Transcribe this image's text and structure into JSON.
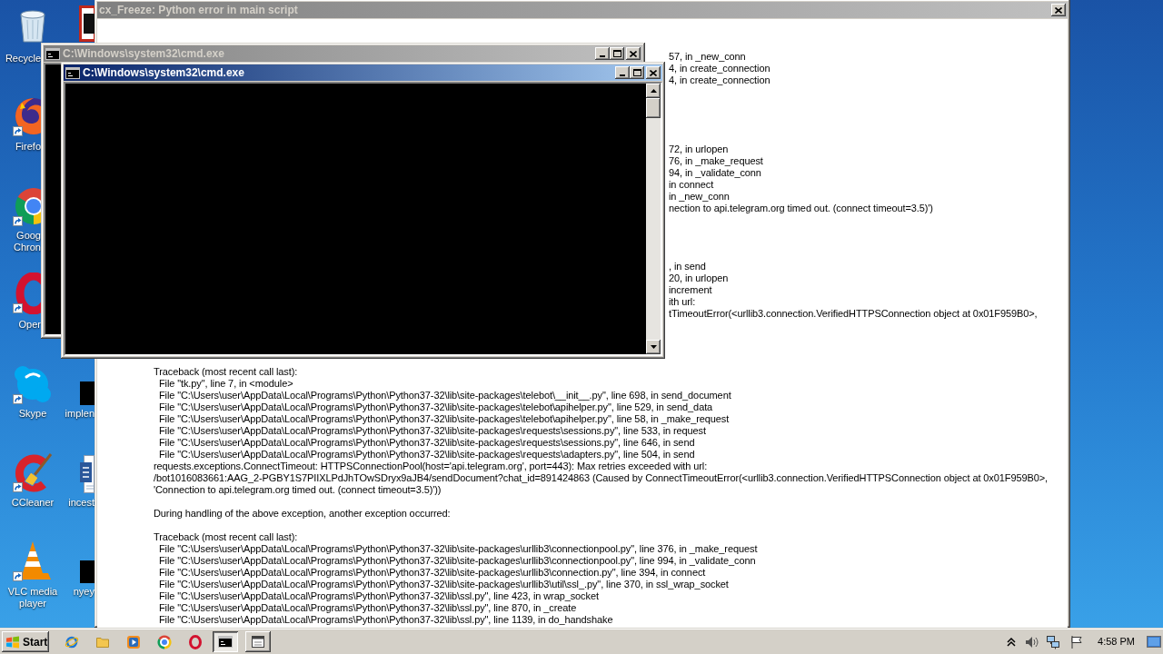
{
  "desktop_icons": [
    {
      "label": "Recycle",
      "shortcut": false
    },
    {
      "label": "Firefo",
      "shortcut": true
    },
    {
      "label": "Goog Chron",
      "shortcut": true
    },
    {
      "label": "Oper",
      "shortcut": true
    },
    {
      "label": "Skype",
      "shortcut": true
    },
    {
      "label": "CCleaner",
      "shortcut": true
    },
    {
      "label": "VLC media player",
      "shortcut": true
    },
    {
      "label": "implen",
      "shortcut": false
    },
    {
      "label": "incest",
      "shortcut": false
    },
    {
      "label": "nyey",
      "shortcut": false
    }
  ],
  "error_window": {
    "title": "cx_Freeze: Python error in main script",
    "active": false,
    "text_blocks": [
      {
        "lines": [
          "57, in _new_conn",
          "4, in create_connection",
          "4, in create_connection"
        ]
      },
      {
        "lines": [
          "72, in urlopen",
          "76, in _make_request",
          "94, in _validate_conn",
          "in connect",
          "in _new_conn",
          "nection to api.telegram.org timed out. (connect timeout=3.5)')"
        ]
      },
      {
        "lines": [
          ", in send",
          "20, in urlopen",
          "increment",
          "ith url:",
          "tTimeoutError(<urllib3.connection.VerifiedHTTPSConnection object at 0x01F959B0>,"
        ]
      },
      {
        "lines": [
          "Traceback (most recent call last):",
          "  File \"tk.py\", line 7, in <module>",
          "  File \"C:\\Users\\user\\AppData\\Local\\Programs\\Python\\Python37-32\\lib\\site-packages\\telebot\\__init__.py\", line 698, in send_document",
          "  File \"C:\\Users\\user\\AppData\\Local\\Programs\\Python\\Python37-32\\lib\\site-packages\\telebot\\apihelper.py\", line 529, in send_data",
          "  File \"C:\\Users\\user\\AppData\\Local\\Programs\\Python\\Python37-32\\lib\\site-packages\\telebot\\apihelper.py\", line 58, in _make_request",
          "  File \"C:\\Users\\user\\AppData\\Local\\Programs\\Python\\Python37-32\\lib\\site-packages\\requests\\sessions.py\", line 533, in request",
          "  File \"C:\\Users\\user\\AppData\\Local\\Programs\\Python\\Python37-32\\lib\\site-packages\\requests\\sessions.py\", line 646, in send",
          "  File \"C:\\Users\\user\\AppData\\Local\\Programs\\Python\\Python37-32\\lib\\site-packages\\requests\\adapters.py\", line 504, in send",
          "requests.exceptions.ConnectTimeout: HTTPSConnectionPool(host='api.telegram.org', port=443): Max retries exceeded with url:",
          "/bot1016083661:AAG_2-PGBY1S7PIIXLPdJhTOwSDryx9aJB4/sendDocument?chat_id=891424863 (Caused by ConnectTimeoutError(<urllib3.connection.VerifiedHTTPSConnection object at 0x01F959B0>,",
          "'Connection to api.telegram.org timed out. (connect timeout=3.5)'))"
        ]
      },
      {
        "lines": [
          "During handling of the above exception, another exception occurred:"
        ]
      },
      {
        "lines": [
          "Traceback (most recent call last):",
          "  File \"C:\\Users\\user\\AppData\\Local\\Programs\\Python\\Python37-32\\lib\\site-packages\\urllib3\\connectionpool.py\", line 376, in _make_request",
          "  File \"C:\\Users\\user\\AppData\\Local\\Programs\\Python\\Python37-32\\lib\\site-packages\\urllib3\\connectionpool.py\", line 994, in _validate_conn",
          "  File \"C:\\Users\\user\\AppData\\Local\\Programs\\Python\\Python37-32\\lib\\site-packages\\urllib3\\connection.py\", line 394, in connect",
          "  File \"C:\\Users\\user\\AppData\\Local\\Programs\\Python\\Python37-32\\lib\\site-packages\\urllib3\\util\\ssl_.py\", line 370, in ssl_wrap_socket",
          "  File \"C:\\Users\\user\\AppData\\Local\\Programs\\Python\\Python37-32\\lib\\ssl.py\", line 423, in wrap_socket",
          "  File \"C:\\Users\\user\\AppData\\Local\\Programs\\Python\\Python37-32\\lib\\ssl.py\", line 870, in _create",
          "  File \"C:\\Users\\user\\AppData\\Local\\Programs\\Python\\Python37-32\\lib\\ssl.py\", line 1139, in do_handshake"
        ]
      }
    ]
  },
  "cmd_windows": [
    {
      "title": "C:\\Windows\\system32\\cmd.exe",
      "active": false
    },
    {
      "title": "C:\\Windows\\system32\\cmd.exe",
      "active": true
    }
  ],
  "taskbar": {
    "start_label": "Start",
    "task_buttons": [
      {
        "selected": true
      },
      {
        "selected": false
      }
    ],
    "clock": "4:58 PM"
  }
}
